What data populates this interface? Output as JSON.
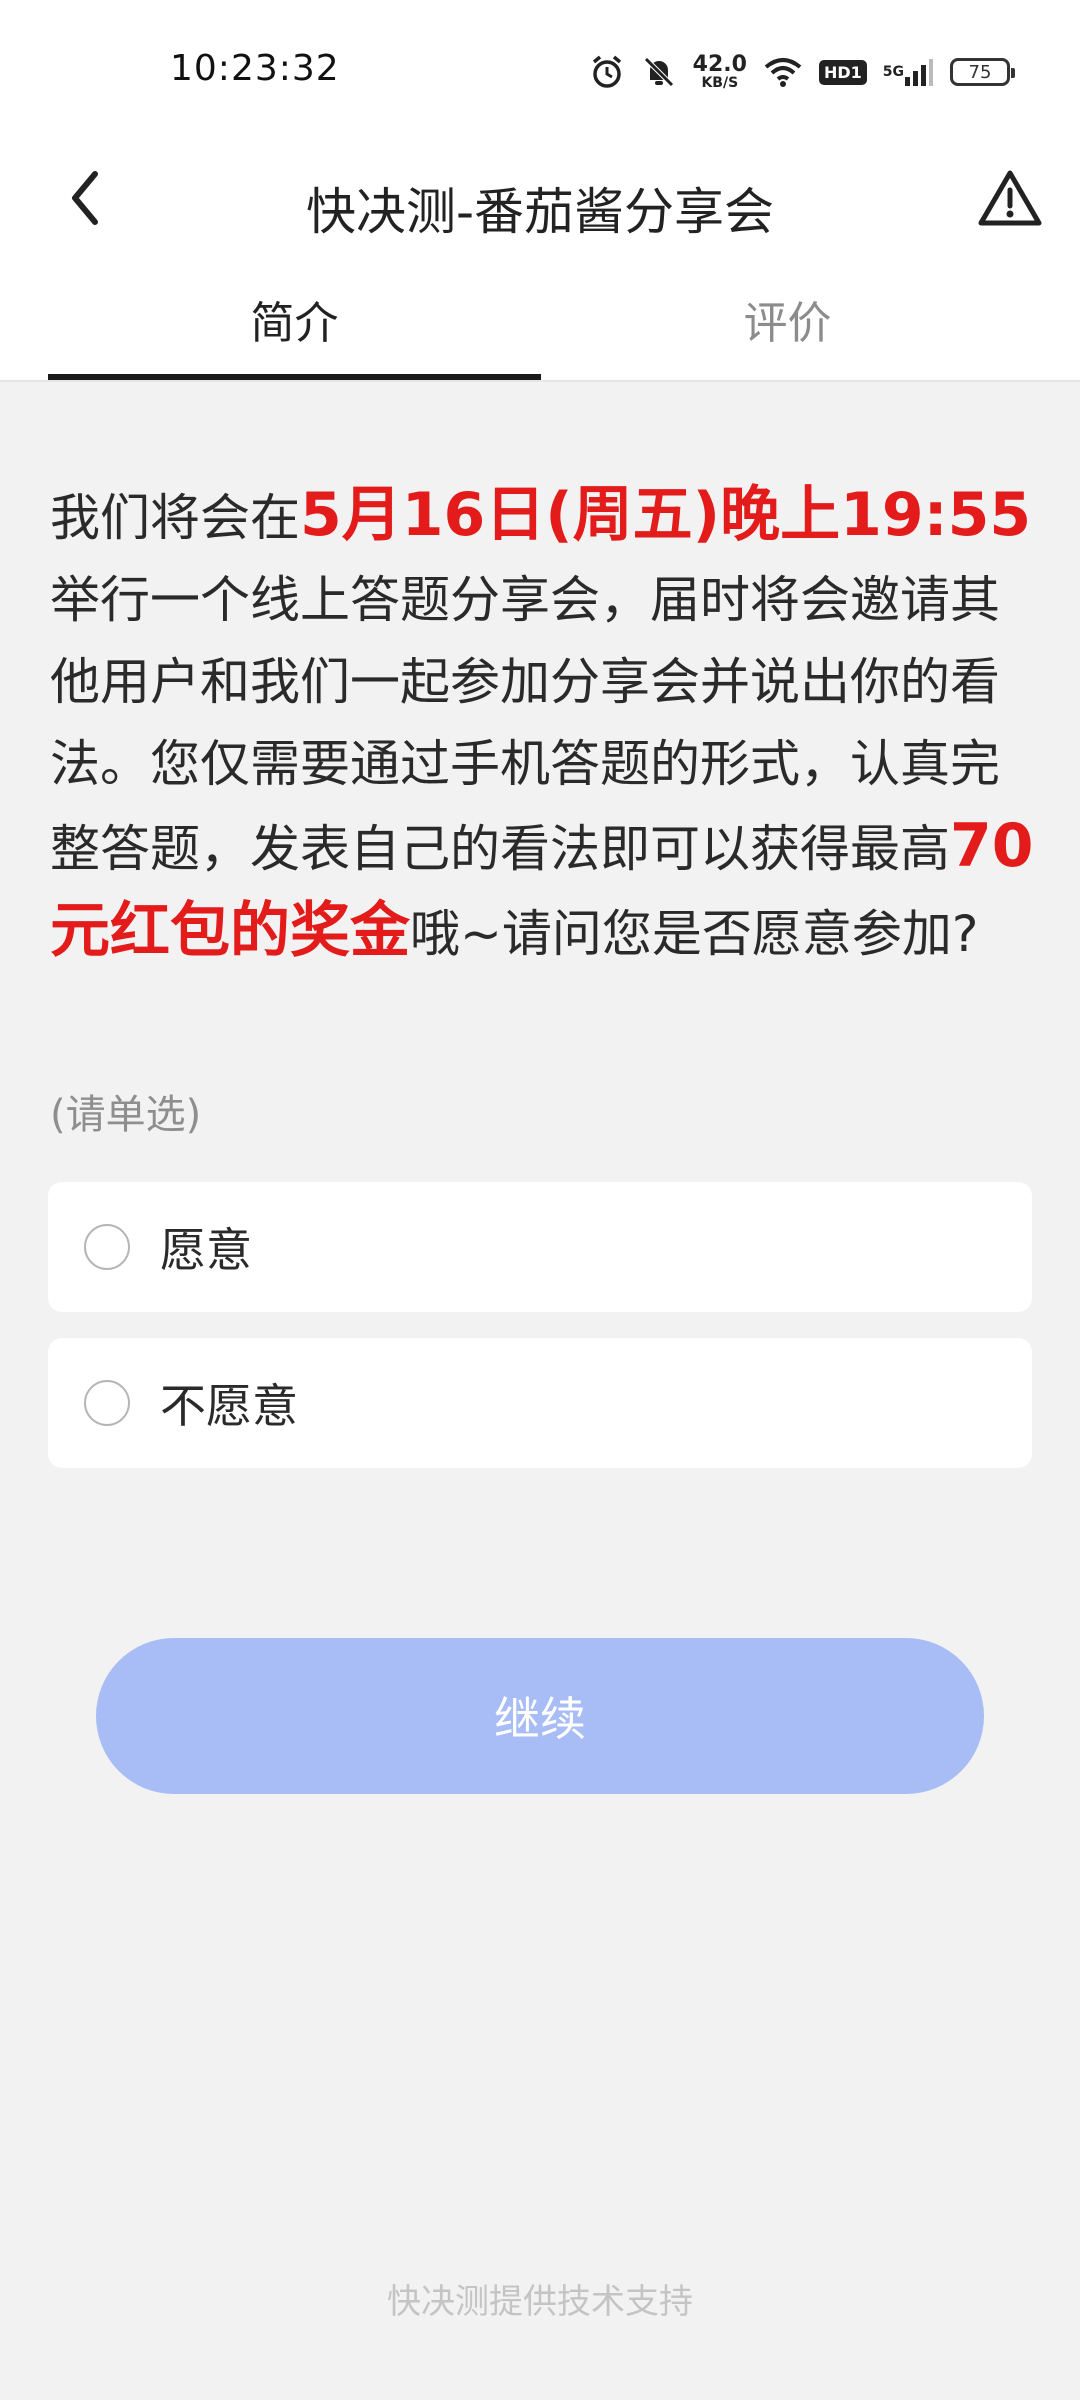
{
  "status_bar": {
    "time": "10:23:32",
    "net_speed_value": "42.0",
    "net_speed_unit": "KB/S",
    "hd_label": "HD1",
    "network_label": "5G",
    "battery": "75"
  },
  "app_bar": {
    "title": "快决测-番茄酱分享会",
    "icons": [
      "back-arrow-icon",
      "warning-icon"
    ]
  },
  "tabs": [
    {
      "label": "简介",
      "active": true
    },
    {
      "label": "评价",
      "active": false
    }
  ],
  "question": {
    "part1": "我们将会在",
    "highlight1": "5月16日(周五)晚上19:55",
    "part2": "举行一个线上答题分享会，届时将会邀请其他用户和我们一起参加分享会并说出你的看法。您仅需要通过手机答题的形式，认真完整答题，发表自己的看法即可以获得最高",
    "highlight2": "70元红包的奖金",
    "part3": "哦~请问您是否愿意参加?",
    "hint": "(请单选)"
  },
  "options": [
    {
      "label": "愿意",
      "selected": false
    },
    {
      "label": "不愿意",
      "selected": false
    }
  ],
  "continue_label": "继续",
  "footer": "快决测提供技术支持",
  "colors": {
    "highlight": "#e31b1b",
    "button_disabled": "#a8bcf6",
    "background": "#f2f2f2"
  }
}
